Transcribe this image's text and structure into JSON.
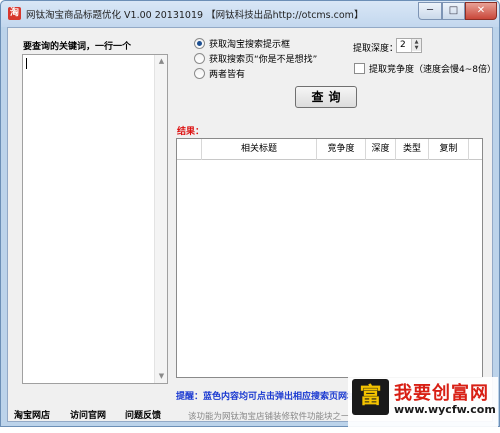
{
  "window": {
    "title": "网钛淘宝商品标题优化 V1.00 20131019 【网钛科技出品http://otcms.com】",
    "minimize": "─",
    "maximize": "□",
    "close": "✕"
  },
  "keywords": {
    "label": "要查询的关键词，一行一个",
    "value": ""
  },
  "options": [
    {
      "label": "获取淘宝搜索提示框",
      "checked": true
    },
    {
      "label": "获取搜索页“你是不是想找”",
      "checked": false
    },
    {
      "label": "两者皆有",
      "checked": false
    }
  ],
  "depth": {
    "label": "提取深度：",
    "value": "2",
    "up": "▲",
    "down": "▼"
  },
  "competition": {
    "label": "提取竞争度（速度会慢4~8倍）",
    "checked": false
  },
  "query_button": "查询",
  "results": {
    "label": "结果：",
    "columns": [
      "",
      "相关标题",
      "竞争度",
      "深度",
      "类型",
      "复制"
    ],
    "rows": []
  },
  "tip": "提醒：蓝色内容均可点击弹出相应搜索页网址",
  "footer_links": [
    "淘宝网店",
    "访问官网",
    "问题反馈"
  ],
  "status": "该功能为网钛淘宝店铺装修软件功能块之一",
  "watermark": {
    "logo": "富",
    "text": "我要创富网",
    "url": "www.wycfw.com"
  },
  "icons": {
    "app": "taobao-app-icon",
    "scroll_up": "scroll-up-arrow-icon",
    "scroll_down": "scroll-down-arrow-icon"
  }
}
